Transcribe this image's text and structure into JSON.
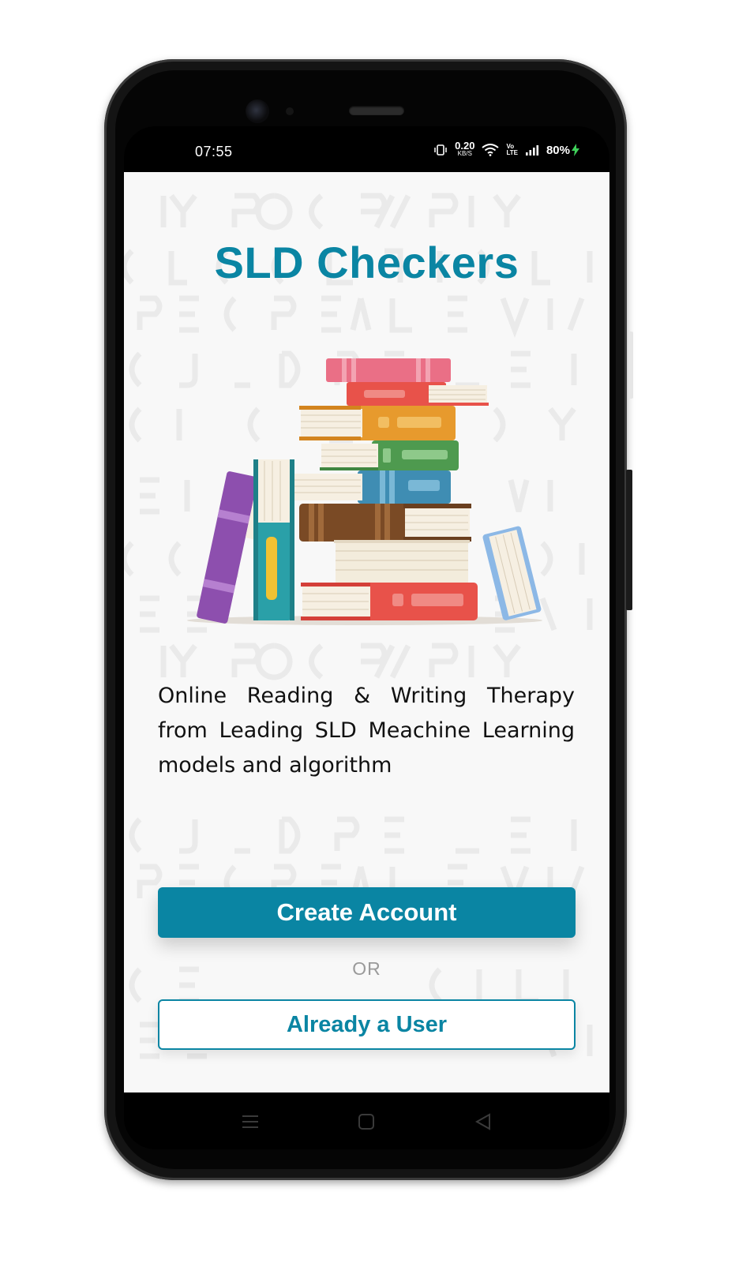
{
  "status_bar": {
    "time": "07:55",
    "net_speed_value": "0.20",
    "net_speed_unit": "KB/S",
    "volte_top": "Vo",
    "volte_bottom": "LTE",
    "battery": "80%"
  },
  "app": {
    "title": "SLD Checkers",
    "tagline": "Online Reading & Writing Therapy from Leading SLD Meachine Learning models and algorithm",
    "create_account_label": "Create Account",
    "or_label": "OR",
    "already_user_label": "Already a User"
  },
  "nav_bar": {
    "items": [
      "menu-icon",
      "home-square-icon",
      "back-triangle-icon"
    ]
  },
  "colors": {
    "accent": "#0a85a3",
    "screen_bg": "#f8f8f8"
  }
}
